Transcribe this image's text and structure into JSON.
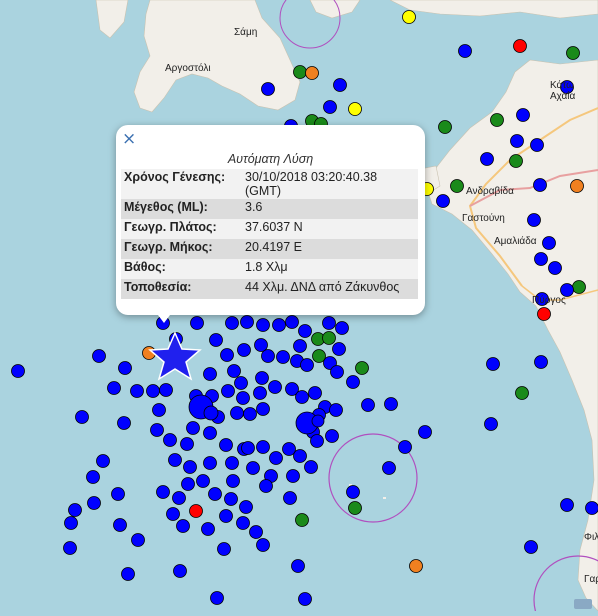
{
  "colors": {
    "sea": "#aad3df",
    "land": "#f2efe9",
    "ring": "#b04fbf",
    "quake_blue": "#0000ff",
    "quake_green": "#1a8a1a",
    "quake_orange": "#f08020",
    "quake_red": "#ff0000",
    "quake_yellow": "#ffff00",
    "star": "#2020ee"
  },
  "map_labels": [
    "Σάμη",
    "Αργοστόλι",
    "Κάτω Αχαΐα",
    "Ανδραβίδα",
    "Γαστούνη",
    "Αμαλιάδα",
    "Πύργος",
    "Φιλ",
    "Γαρ"
  ],
  "popup": {
    "close_icon": "×",
    "title": "Αυτόματη Λύση",
    "rows": [
      {
        "label": "Χρόνος Γένεσης:",
        "value": "30/10/2018 03:20:40.38 (GMT)"
      },
      {
        "label": "Μέγεθος (ML):",
        "value": "3.6"
      },
      {
        "label": "Γεωγρ. Πλάτος:",
        "value": "37.6037 N"
      },
      {
        "label": "Γεωγρ. Μήκος:",
        "value": "20.4197 E"
      },
      {
        "label": "Βάθος:",
        "value": "1.8 Χλμ"
      },
      {
        "label": "Τοποθεσία:",
        "value": "44 Χλμ. ΔΝΔ από Ζάκυνθος"
      }
    ]
  }
}
